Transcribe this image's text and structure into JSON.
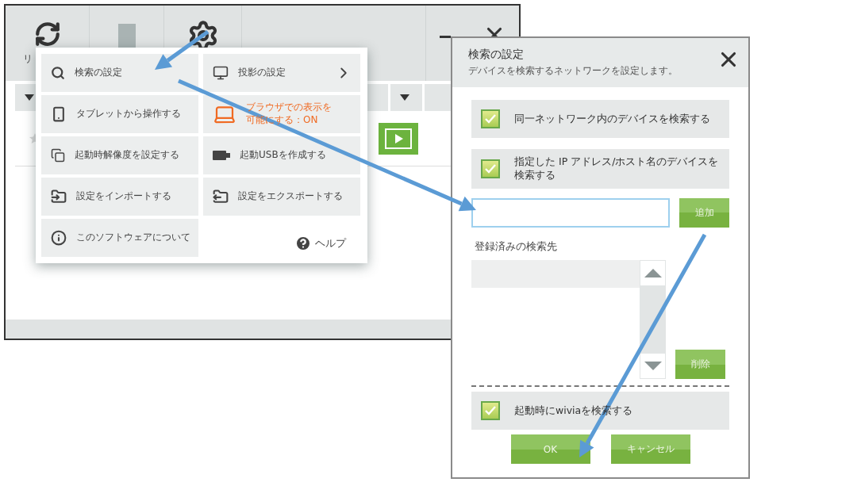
{
  "main_window": {
    "toolbar_label": "リ"
  },
  "menu": {
    "columns": [
      [
        {
          "kind": "search",
          "label": "検索の設定",
          "submenu": false,
          "highlighted": false
        },
        {
          "kind": "tablet",
          "label": "タブレットから操作する",
          "submenu": false,
          "highlighted": false
        },
        {
          "kind": "resolution",
          "label": "起動時解像度を設定する",
          "submenu": false,
          "highlighted": false
        },
        {
          "kind": "import",
          "label": "設定をインポートする",
          "submenu": false,
          "highlighted": false
        },
        {
          "kind": "about",
          "label": "このソフトウェアについて",
          "submenu": false,
          "highlighted": false
        }
      ],
      [
        {
          "kind": "projection",
          "label": "投影の設定",
          "submenu": true,
          "highlighted": false
        },
        {
          "kind": "browser",
          "label": "ブラウザでの表示を可能にする：ON",
          "submenu": false,
          "highlighted": true
        },
        {
          "kind": "usb",
          "label": "起動USBを作成する",
          "submenu": false,
          "highlighted": false
        },
        {
          "kind": "export",
          "label": "設定をエクスポートする",
          "submenu": false,
          "highlighted": false
        }
      ]
    ],
    "help": "ヘルプ"
  },
  "dialog": {
    "title": "検索の設定",
    "subtitle": "デバイスを検索するネットワークを設定します。",
    "options": [
      {
        "label": "同一ネットワーク内のデバイスを検索する",
        "checked": true
      },
      {
        "label": "指定した IP アドレス/ホスト名のデバイスを検索する",
        "checked": true
      }
    ],
    "add_button": "追加",
    "registered_label": "登録済みの検索先",
    "delete_button": "削除",
    "startup_option": {
      "label": "起動時にwiviaを検索する",
      "checked": true
    },
    "buttons": [
      "OK",
      "キャンセル"
    ]
  }
}
